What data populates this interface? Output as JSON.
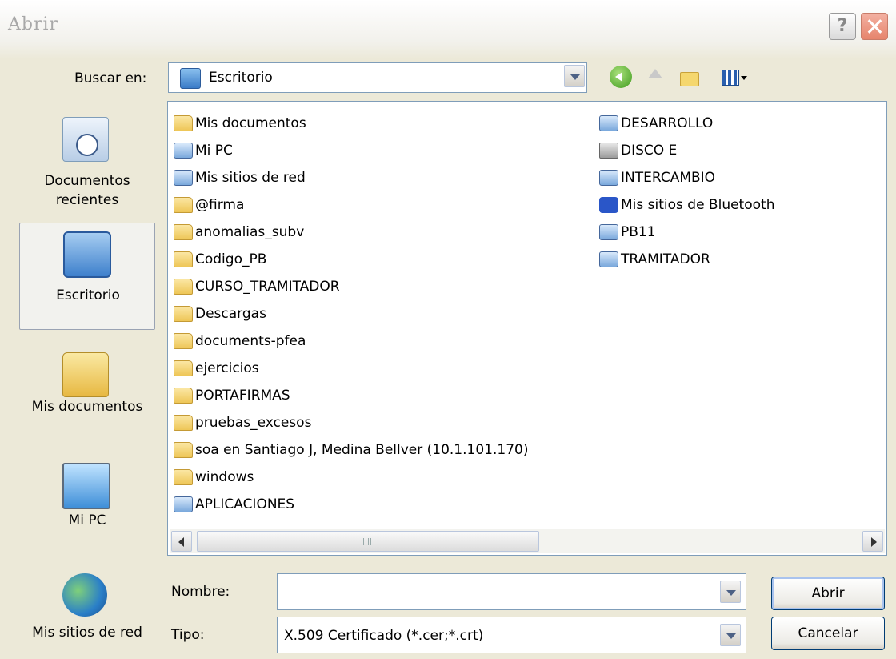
{
  "window": {
    "title": "Abrir",
    "help_label": "?",
    "close_label": "×"
  },
  "lookin": {
    "label": "Buscar en:",
    "value": "Escritorio"
  },
  "toolbar": {
    "back": "Atrás",
    "up": "Subir un nivel",
    "new_folder": "Crear nueva carpeta",
    "view": "Menú Ver"
  },
  "places": [
    {
      "label": "Documentos recientes",
      "icon": "recent-documents-icon"
    },
    {
      "label": "Escritorio",
      "icon": "desktop-icon"
    },
    {
      "label": "Mis documentos",
      "icon": "my-documents-icon"
    },
    {
      "label": "Mi PC",
      "icon": "my-computer-icon"
    },
    {
      "label": "Mis sitios de red",
      "icon": "network-places-icon"
    }
  ],
  "files_col1": [
    {
      "name": "Mis documentos",
      "icon": "my-documents-icon"
    },
    {
      "name": "Mi PC",
      "icon": "my-computer-icon"
    },
    {
      "name": "Mis sitios de red",
      "icon": "network-places-icon"
    },
    {
      "name": "@firma",
      "icon": "folder-icon"
    },
    {
      "name": "anomalias_subv",
      "icon": "folder-icon"
    },
    {
      "name": "Codigo_PB",
      "icon": "folder-icon"
    },
    {
      "name": "CURSO_TRAMITADOR",
      "icon": "folder-icon"
    },
    {
      "name": "Descargas",
      "icon": "folder-icon"
    },
    {
      "name": "documents-pfea",
      "icon": "folder-icon"
    },
    {
      "name": "ejercicios",
      "icon": "folder-icon"
    },
    {
      "name": "PORTAFIRMAS",
      "icon": "folder-icon"
    },
    {
      "name": "pruebas_excesos",
      "icon": "folder-icon"
    },
    {
      "name": "soa en Santiago J, Medina Bellver (10.1.101.170)",
      "icon": "folder-icon"
    },
    {
      "name": "windows",
      "icon": "folder-icon"
    },
    {
      "name": "APLICACIONES",
      "icon": "shortcut-icon"
    }
  ],
  "files_col2": [
    {
      "name": "DESARROLLO",
      "icon": "shortcut-icon"
    },
    {
      "name": "DISCO E",
      "icon": "drive-shortcut-icon"
    },
    {
      "name": "INTERCAMBIO",
      "icon": "network-shortcut-icon"
    },
    {
      "name": "Mis sitios de Bluetooth",
      "icon": "bluetooth-icon"
    },
    {
      "name": "PB11",
      "icon": "shortcut-icon"
    },
    {
      "name": "TRAMITADOR",
      "icon": "network-shortcut-icon"
    }
  ],
  "filename": {
    "label": "Nombre:",
    "value": ""
  },
  "filetype": {
    "label": "Tipo:",
    "value": "X.509 Certificado (*.cer;*.crt)"
  },
  "buttons": {
    "open": "Abrir",
    "cancel": "Cancelar"
  }
}
